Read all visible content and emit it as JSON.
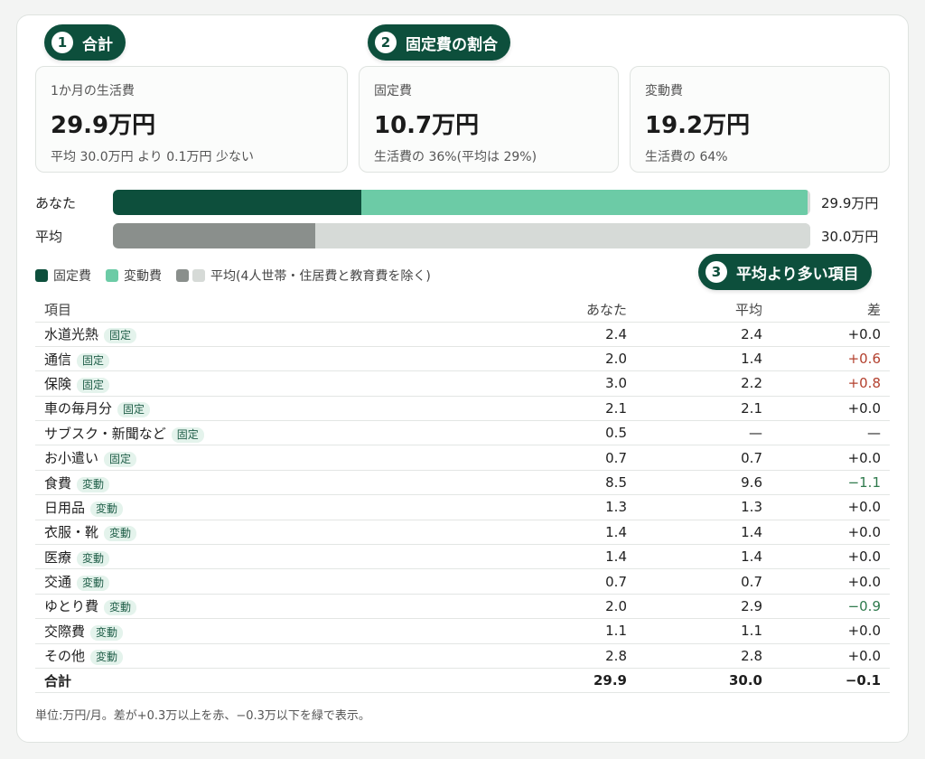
{
  "badges": {
    "b1": {
      "num": "1",
      "label": "合計"
    },
    "b2": {
      "num": "2",
      "label": "固定費の割合"
    },
    "b3": {
      "num": "3",
      "label": "平均より多い項目"
    }
  },
  "stats": {
    "total": {
      "label": "1か月の生活費",
      "value": "29.9万円",
      "sub": "平均 30.0万円 より 0.1万円 少ない"
    },
    "fixed": {
      "label": "固定費",
      "value": "10.7万円",
      "sub": "生活費の 36%(平均は 29%)"
    },
    "variable": {
      "label": "変動費",
      "value": "19.2万円",
      "sub": "生活費の 64%"
    }
  },
  "bars": {
    "scale_max": 30.0,
    "you": {
      "label": "あなた",
      "fixed": 10.7,
      "variable": 19.2,
      "total_label": "29.9万円"
    },
    "avg": {
      "label": "平均",
      "fixed": 8.7,
      "variable": 21.3,
      "total_label": "30.0万円"
    }
  },
  "colors": {
    "fixed": "#0d4f3c",
    "variable": "#6ccba6",
    "avg_fixed": "#8a8f8c",
    "avg_variable": "#d6dad7"
  },
  "legend": {
    "fixed": "固定費",
    "variable": "変動費",
    "avg": "平均(4人世帯・住居費と教育費を除く)"
  },
  "table": {
    "headers": {
      "item": "項目",
      "you": "あなた",
      "avg": "平均",
      "diff": "差"
    },
    "rows": [
      {
        "item": "水道光熱",
        "tag": "固定",
        "you": "2.4",
        "avg": "2.4",
        "diff": "+0.0",
        "trend": ""
      },
      {
        "item": "通信",
        "tag": "固定",
        "you": "2.0",
        "avg": "1.4",
        "diff": "+0.6",
        "trend": "up"
      },
      {
        "item": "保険",
        "tag": "固定",
        "you": "3.0",
        "avg": "2.2",
        "diff": "+0.8",
        "trend": "up"
      },
      {
        "item": "車の毎月分",
        "tag": "固定",
        "you": "2.1",
        "avg": "2.1",
        "diff": "+0.0",
        "trend": ""
      },
      {
        "item": "サブスク・新聞など",
        "tag": "固定",
        "you": "0.5",
        "avg": "—",
        "diff": "—",
        "trend": ""
      },
      {
        "item": "お小遣い",
        "tag": "固定",
        "you": "0.7",
        "avg": "0.7",
        "diff": "+0.0",
        "trend": ""
      },
      {
        "item": "食費",
        "tag": "変動",
        "you": "8.5",
        "avg": "9.6",
        "diff": "−1.1",
        "trend": "down"
      },
      {
        "item": "日用品",
        "tag": "変動",
        "you": "1.3",
        "avg": "1.3",
        "diff": "+0.0",
        "trend": ""
      },
      {
        "item": "衣服・靴",
        "tag": "変動",
        "you": "1.4",
        "avg": "1.4",
        "diff": "+0.0",
        "trend": ""
      },
      {
        "item": "医療",
        "tag": "変動",
        "you": "1.4",
        "avg": "1.4",
        "diff": "+0.0",
        "trend": ""
      },
      {
        "item": "交通",
        "tag": "変動",
        "you": "0.7",
        "avg": "0.7",
        "diff": "+0.0",
        "trend": ""
      },
      {
        "item": "ゆとり費",
        "tag": "変動",
        "you": "2.0",
        "avg": "2.9",
        "diff": "−0.9",
        "trend": "down"
      },
      {
        "item": "交際費",
        "tag": "変動",
        "you": "1.1",
        "avg": "1.1",
        "diff": "+0.0",
        "trend": ""
      },
      {
        "item": "その他",
        "tag": "変動",
        "you": "2.8",
        "avg": "2.8",
        "diff": "+0.0",
        "trend": ""
      }
    ],
    "total": {
      "item": "合計",
      "you": "29.9",
      "avg": "30.0",
      "diff": "−0.1"
    }
  },
  "footnote": "単位:万円/月。差が+0.3万以上を赤、−0.3万以下を緑で表示。"
}
